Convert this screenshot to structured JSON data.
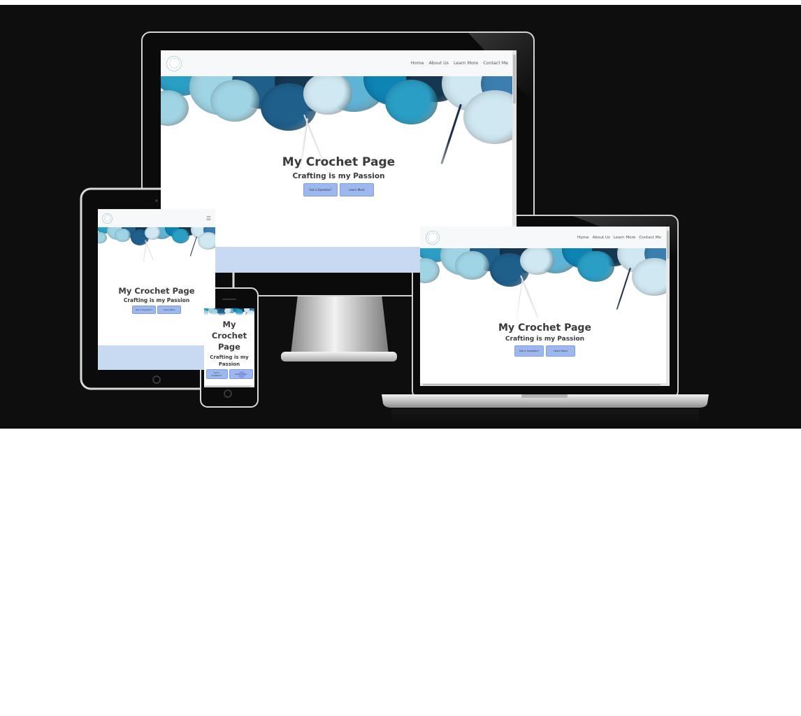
{
  "site": {
    "title": "My Crochet Page",
    "subtitle": "Crafting is my Passion",
    "nav": [
      "Home",
      "About Us",
      "Learn More",
      "Contact Me"
    ],
    "buttons": {
      "question": "Got a Question?",
      "learn": "Learn More"
    },
    "phone": {
      "title_lines": [
        "My",
        "Crochet",
        "Page"
      ],
      "subtitle_lines": [
        "Crafting is my",
        "Passion"
      ],
      "question_lines": [
        "Got a",
        "Question?"
      ],
      "learn": "Learn More"
    },
    "menu_icon": "hamburger-icon"
  },
  "colors": {
    "background": "#0e0e0f",
    "nav": "#f7f8fa",
    "button": "#9db8ee",
    "band": "#c8d9f2",
    "yarn": [
      "#2a9ec5",
      "#9fd4e4",
      "#1f5f8b",
      "#15374f",
      "#5fb4d6",
      "#0e84b5",
      "#cfe8f1",
      "#3a7fb0"
    ]
  }
}
